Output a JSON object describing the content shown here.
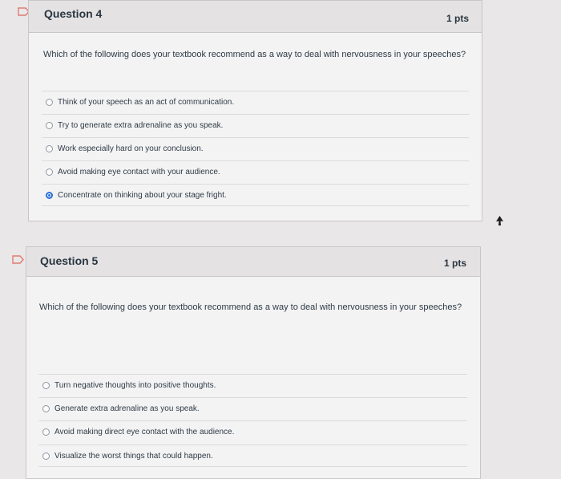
{
  "questions": [
    {
      "title": "Question 4",
      "points": "1 pts",
      "prompt": "Which of the following does your textbook recommend as a way to deal with nervousness in your speeches?",
      "answers": [
        {
          "label": "Think of your speech as an act of communication.",
          "selected": false
        },
        {
          "label": "Try to generate extra adrenaline as you speak.",
          "selected": false
        },
        {
          "label": "Work especially hard on your conclusion.",
          "selected": false
        },
        {
          "label": "Avoid making eye contact with your audience.",
          "selected": false
        },
        {
          "label": "Concentrate on thinking about your stage fright.",
          "selected": true
        }
      ]
    },
    {
      "title": "Question 5",
      "points": "1 pts",
      "prompt": "Which of the following does your textbook recommend as a way to deal with nervousness in your speeches?",
      "answers": [
        {
          "label": "Turn negative thoughts into positive thoughts.",
          "selected": false
        },
        {
          "label": "Generate extra adrenaline as you speak.",
          "selected": false
        },
        {
          "label": "Avoid making direct eye contact with the audience.",
          "selected": false
        },
        {
          "label": "Visualize the worst things that could happen.",
          "selected": false
        }
      ]
    }
  ],
  "icons": {
    "flag": "flag-question-icon",
    "cursor": "mouse-pointer-icon"
  },
  "colors": {
    "selected_radio": "#2a6fd6",
    "flag": "#d9534f"
  }
}
